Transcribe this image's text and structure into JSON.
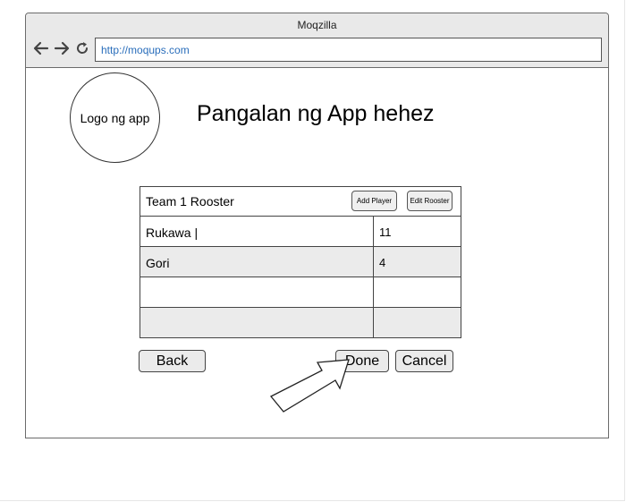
{
  "browser": {
    "title": "Moqzilla",
    "url": "http://moqups.com"
  },
  "header": {
    "logo_text": "Logo ng app",
    "app_title": "Pangalan ng App hehez"
  },
  "roster": {
    "title": "Team 1 Rooster",
    "add_player_label": "Add Player",
    "edit_roster_label": "Edit Rooster",
    "rows": [
      {
        "name": "Rukawa |",
        "number": "11"
      },
      {
        "name": "Gori",
        "number": "4"
      },
      {
        "name": "",
        "number": ""
      },
      {
        "name": "",
        "number": ""
      }
    ]
  },
  "actions": {
    "back_label": "Back",
    "done_label": "Done",
    "cancel_label": "Cancel"
  },
  "icons": {
    "back": "arrow-left-icon",
    "forward": "arrow-right-icon",
    "reload": "reload-icon",
    "pointer": "arrow-pointer-icon"
  }
}
